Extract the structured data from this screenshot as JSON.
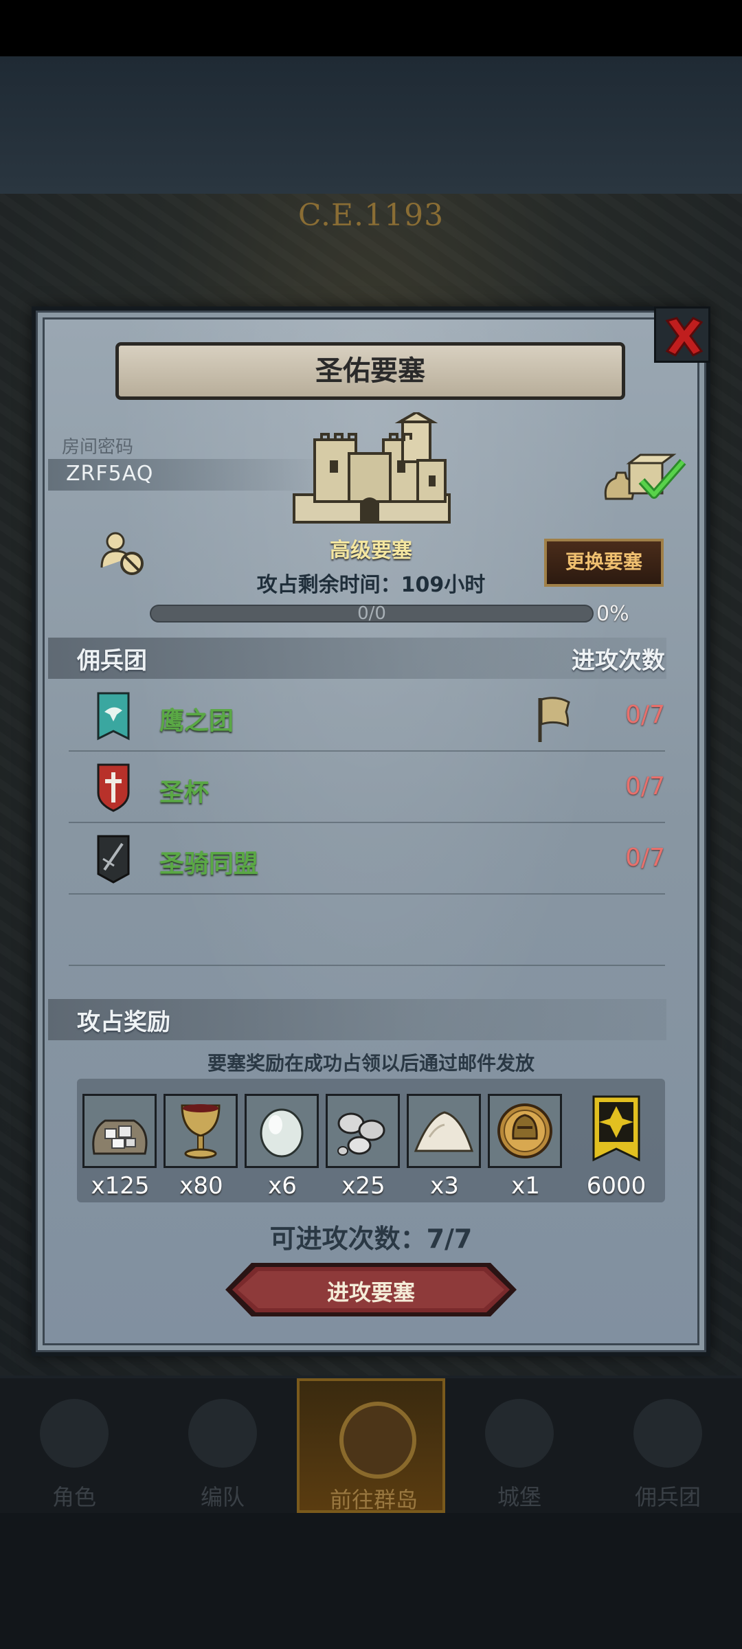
{
  "era": "C.E.1193",
  "modal": {
    "title": "圣佑要塞",
    "room_code_label": "房间密码",
    "room_code": "ZRF5AQ",
    "fortress_type": "高级要塞",
    "change_button": "更换要塞",
    "time_remaining": "攻占剩余时间：109小时",
    "progress_text": "0/0",
    "progress_percent": "0%",
    "progress_value": 0
  },
  "mercenaries": {
    "header": "佣兵团",
    "attack_count_header": "进攻次数",
    "rows": [
      {
        "name": "鹰之团",
        "count": "0/7",
        "emblem": "eagle-banner-icon",
        "color": "#3aa7a0"
      },
      {
        "name": "圣杯",
        "count": "0/7",
        "emblem": "red-cross-shield-icon",
        "color": "#b8312a"
      },
      {
        "name": "圣骑同盟",
        "count": "0/7",
        "emblem": "black-sword-banner-icon",
        "color": "#2a2e30"
      }
    ]
  },
  "rewards": {
    "header": "攻占奖励",
    "note": "要塞奖励在成功占领以后通过邮件发放",
    "items": [
      {
        "icon": "silver-ore-sack-icon",
        "qty": "x125"
      },
      {
        "icon": "golden-chalice-icon",
        "qty": "x80"
      },
      {
        "icon": "pearl-gem-icon",
        "qty": "x6"
      },
      {
        "icon": "silver-ingots-icon",
        "qty": "x25"
      },
      {
        "icon": "salt-pile-icon",
        "qty": "x3"
      },
      {
        "icon": "knight-helmet-coin-icon",
        "qty": "x1"
      },
      {
        "icon": "gold-banner-icon",
        "qty": "6000"
      }
    ]
  },
  "attacks_left": "可进攻次数：7/7",
  "attack_button": "进攻要塞",
  "nav": [
    {
      "label": "角色",
      "icon": "knight-icon"
    },
    {
      "label": "编队",
      "icon": "squad-icon"
    },
    {
      "label": "前往群岛",
      "icon": "compass-icon"
    },
    {
      "label": "城堡",
      "icon": "castle-icon"
    },
    {
      "label": "佣兵团",
      "icon": "mercenary-icon"
    }
  ]
}
